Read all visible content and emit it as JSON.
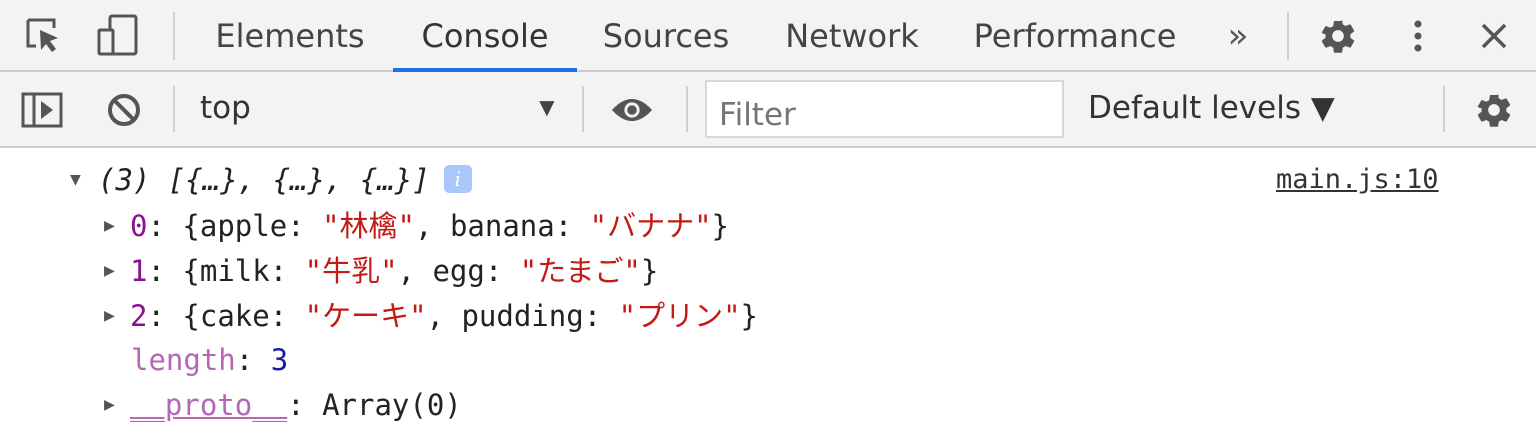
{
  "tabbar": {
    "tabs": [
      {
        "label": "Elements",
        "active": false
      },
      {
        "label": "Console",
        "active": true
      },
      {
        "label": "Sources",
        "active": false
      },
      {
        "label": "Network",
        "active": false
      },
      {
        "label": "Performance",
        "active": false
      }
    ],
    "more_label": "»",
    "accent": "#1a73e8"
  },
  "toolbar": {
    "context": "top",
    "context_arrow": "▼",
    "filter_placeholder": "Filter",
    "levels_label": "Default levels ▼"
  },
  "console": {
    "source_link": "main.js:10",
    "summary": "(3) [{…}, {…}, {…}]",
    "info_badge": "i",
    "items": [
      {
        "index": "0",
        "open": "{",
        "k1": "apple",
        "v1": "\"林檎\"",
        "k2": "banana",
        "v2": "\"バナナ\"",
        "close": "}"
      },
      {
        "index": "1",
        "open": "{",
        "k1": "milk",
        "v1": "\"牛乳\"",
        "k2": "egg",
        "v2": "\"たまご\"",
        "close": "}"
      },
      {
        "index": "2",
        "open": "{",
        "k1": "cake",
        "v1": "\"ケーキ\"",
        "k2": "pudding",
        "v2": "\"プリン\"",
        "close": "}"
      }
    ],
    "length_key": "length",
    "length_value": "3",
    "proto_key": "__proto__",
    "proto_value": "Array(0)"
  }
}
